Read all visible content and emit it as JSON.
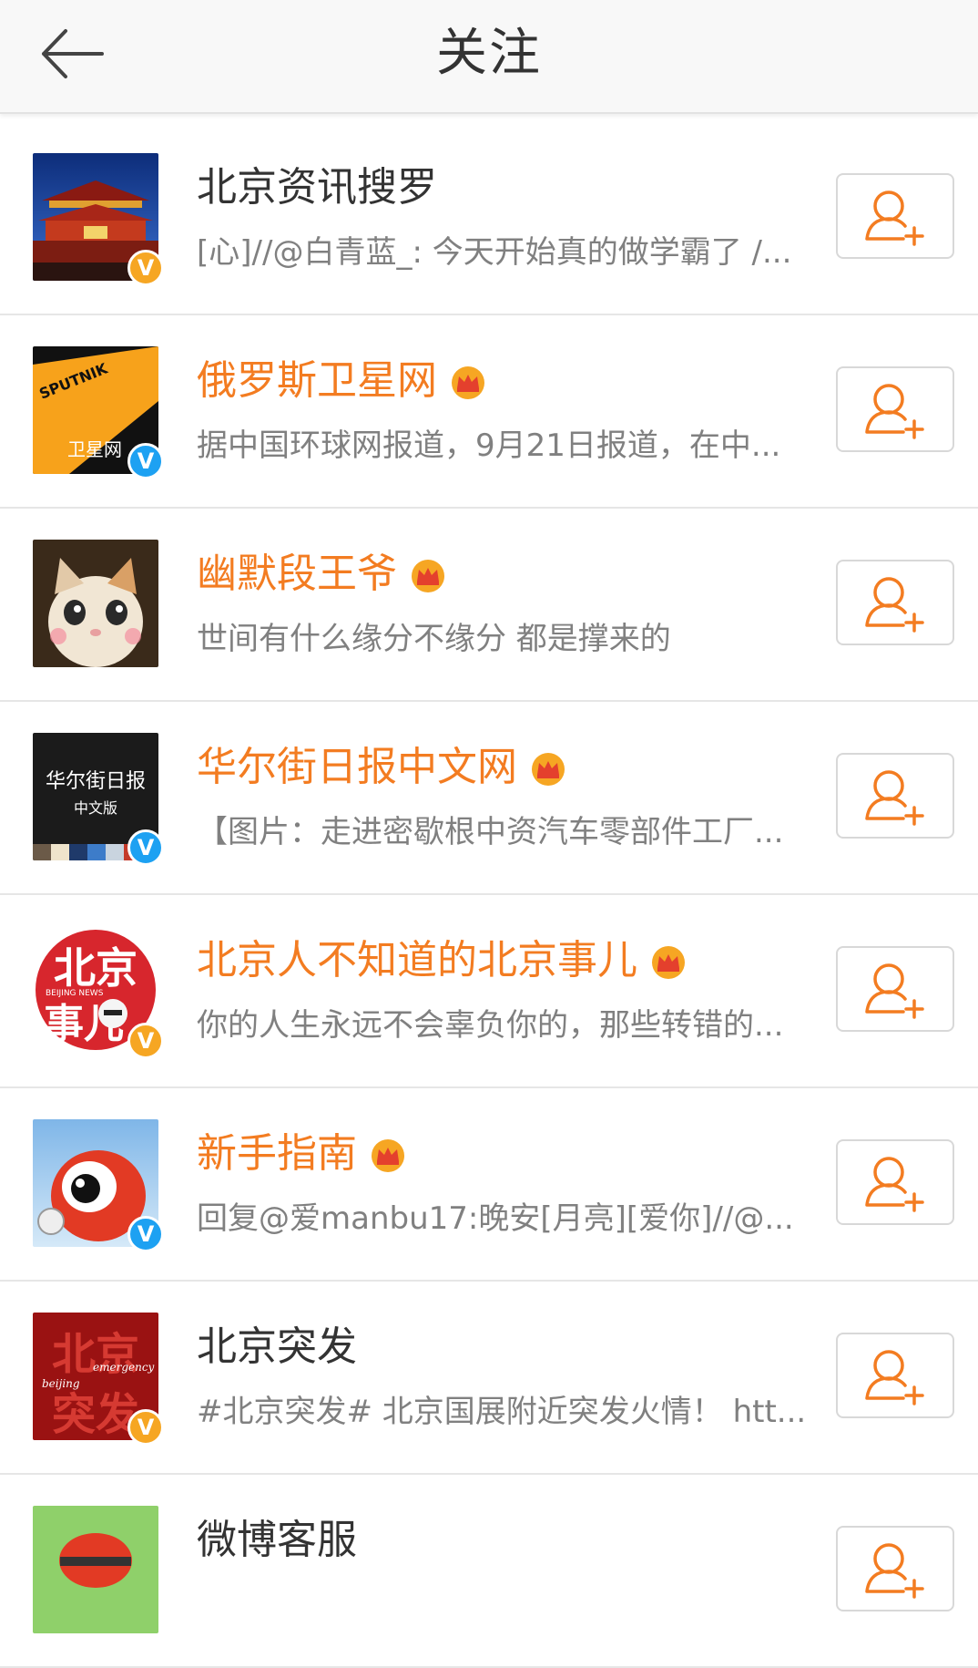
{
  "header": {
    "title": "关注",
    "back_icon": "back-arrow-icon"
  },
  "colors": {
    "vip_name": "#f37c21",
    "accent": "#f37c21",
    "verified_yellow": "#f6a623",
    "verified_blue": "#1da1f2"
  },
  "items": [
    {
      "name": "北京资讯搜罗",
      "desc": "[心]//@白青蓝_: 今天开始真的做学霸了 /...",
      "vip": false,
      "verified": "yellow",
      "avatar": "tiananmen-avatar"
    },
    {
      "name": "俄罗斯卫星网",
      "desc": "据中国环球网报道，9月21日报道，在中...",
      "vip": true,
      "verified": "blue",
      "avatar": "sputnik-avatar",
      "avatar_text": [
        "SPUTNIK",
        "卫星网"
      ]
    },
    {
      "name": "幽默段王爷",
      "desc": "世间有什么缘分不缘分 都是撑来的",
      "vip": true,
      "verified": "none",
      "avatar": "cat-avatar"
    },
    {
      "name": "华尔街日报中文网",
      "desc": "【图片：走进密歇根中资汽车零部件工厂...",
      "vip": true,
      "verified": "blue",
      "avatar": "wsj-avatar",
      "avatar_text": [
        "华尔街日报",
        "中文版"
      ]
    },
    {
      "name": "北京人不知道的北京事儿",
      "desc": "你的人生永远不会辜负你的，那些转错的...",
      "vip": true,
      "verified": "yellow",
      "avatar": "beijing-news-avatar",
      "avatar_text": [
        "北京",
        "事儿",
        "BEIJING NEWS"
      ]
    },
    {
      "name": "新手指南",
      "desc": "回复@爱manbu17:晚安[月亮][爱你]//@...",
      "vip": true,
      "verified": "blue",
      "avatar": "weibo-mascot-avatar"
    },
    {
      "name": "北京突发",
      "desc": "#北京突发# 北京国展附近突发火情！ htt...",
      "vip": false,
      "verified": "yellow",
      "avatar": "beijing-emergency-avatar",
      "avatar_text": [
        "北京",
        "突发",
        "beijing",
        "emergency"
      ]
    },
    {
      "name": "微博客服",
      "desc": "",
      "vip": false,
      "verified": "none",
      "avatar": "weibo-service-avatar"
    }
  ]
}
